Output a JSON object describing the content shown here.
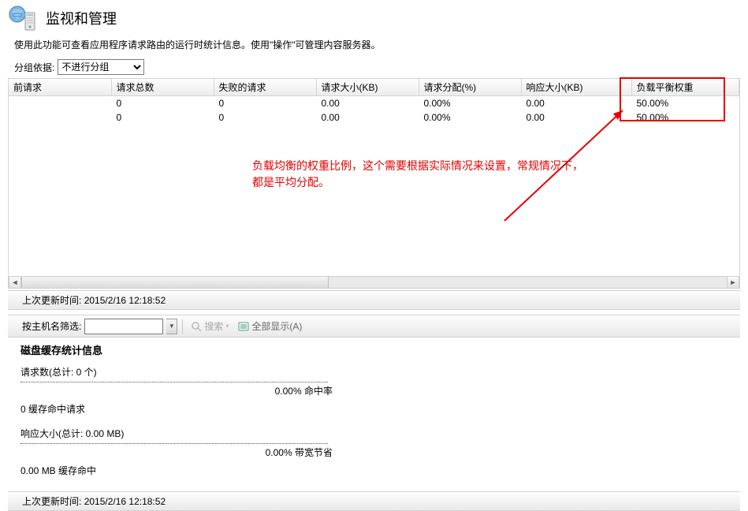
{
  "header": {
    "title": "监视和管理"
  },
  "description": "使用此功能可查看应用程序请求路由的运行时统计信息。使用\"操作\"可管理内容服务器。",
  "group": {
    "label": "分组依据:",
    "selected": "不进行分组"
  },
  "table": {
    "columns": [
      "前请求",
      "请求总数",
      "失败的请求",
      "请求大小(KB)",
      "请求分配(%)",
      "响应大小(KB)",
      "负载平衡权重"
    ],
    "rows": [
      [
        "",
        "0",
        "0",
        "0.00",
        "0.00%",
        "0.00",
        "50.00%"
      ],
      [
        "",
        "0",
        "0",
        "0.00",
        "0.00%",
        "0.00",
        "50.00%"
      ]
    ]
  },
  "status1": {
    "label": "上次更新时间:",
    "value": "2015/2/16 12:18:52"
  },
  "toolbar": {
    "filter_label": "按主机名筛选:",
    "filter_value": "",
    "search_label": "搜索",
    "showall_label": "全部显示(A)"
  },
  "stats": {
    "title": "磁盘缓存统计信息",
    "block1": {
      "line1": "请求数(总计: 0 个)",
      "rate": "0.00% 命中率",
      "line3": "0 缓存命中请求"
    },
    "block2": {
      "line1": "响应大小(总计: 0.00 MB)",
      "rate": "0.00% 带宽节省",
      "line3": "0.00 MB 缓存命中"
    }
  },
  "status2": {
    "label": "上次更新时间:",
    "value": "2015/2/16 12:18:52"
  },
  "annotation": {
    "text_line1": "负载均衡的权重比例，这个需要根据实际情况来设置，常规情况下，",
    "text_line2": "都是平均分配。"
  }
}
